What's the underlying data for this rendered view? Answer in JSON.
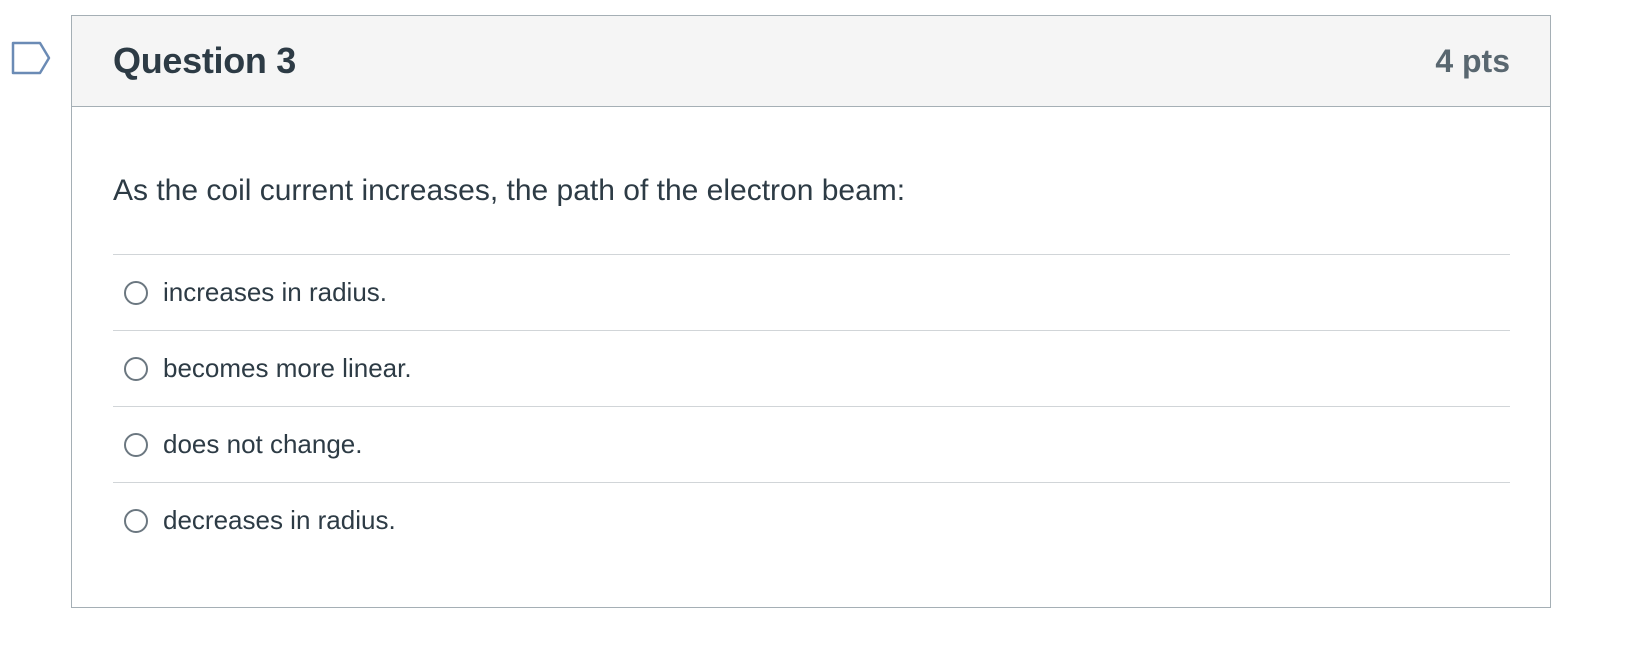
{
  "question": {
    "title": "Question 3",
    "points": "4 pts",
    "text": "As the coil current increases, the path of the electron beam:",
    "flag_icon": "flag-outline-icon",
    "answers": [
      {
        "label": "increases in radius.",
        "selected": false
      },
      {
        "label": "becomes more linear.",
        "selected": false
      },
      {
        "label": "does not change.",
        "selected": false
      },
      {
        "label": "decreases in radius.",
        "selected": false
      }
    ]
  },
  "colors": {
    "text": "#2d3b45",
    "points": "#596770",
    "header_bg": "#f5f5f5",
    "border": "#a5afb5",
    "divider": "#d1d5d8",
    "flag_stroke": "#6b8bb5"
  }
}
